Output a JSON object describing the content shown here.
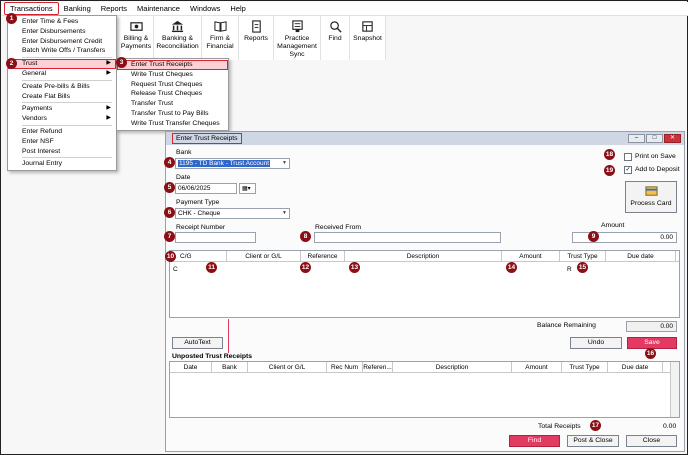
{
  "menubar": [
    "Transactions",
    "Banking",
    "Reports",
    "Maintenance",
    "Windows",
    "Help"
  ],
  "toolbar": [
    {
      "label": "Billing &\nPayments",
      "icon": "billing-icon"
    },
    {
      "label": "Banking &\nReconciliation",
      "icon": "bank-icon"
    },
    {
      "label": "Firm &\nFinancial",
      "icon": "book-icon"
    },
    {
      "label": "Reports",
      "icon": "report-icon"
    },
    {
      "label": "Practice\nManagement\nSync",
      "icon": "sync-icon"
    },
    {
      "label": "Find",
      "icon": "search-icon"
    },
    {
      "label": "Snapshot",
      "icon": "snapshot-icon"
    }
  ],
  "transactions_menu": [
    {
      "label": "Enter Time & Fees"
    },
    {
      "label": "Enter Disbursements"
    },
    {
      "label": "Enter Disbursement Credit"
    },
    {
      "label": "Batch Write Offs / Transfers"
    },
    {
      "sep": true
    },
    {
      "label": "Trust",
      "submenu": true
    },
    {
      "label": "General",
      "submenu": true
    },
    {
      "sep": true
    },
    {
      "label": "Create Pre-bills & Bills"
    },
    {
      "label": "Create Flat Bills"
    },
    {
      "sep": true
    },
    {
      "label": "Payments",
      "submenu": true
    },
    {
      "label": "Vendors",
      "submenu": true
    },
    {
      "sep": true
    },
    {
      "label": "Enter Refund"
    },
    {
      "label": "Enter NSF"
    },
    {
      "label": "Post Interest"
    },
    {
      "sep": true
    },
    {
      "label": "Journal Entry"
    }
  ],
  "trust_submenu": [
    "Enter Trust Receipts",
    "Write Trust Cheques",
    "Request Trust Cheques",
    "Release Trust Cheques",
    "Transfer Trust",
    "Transfer Trust to Pay Bills",
    "Write Trust Transfer Cheques"
  ],
  "dialog": {
    "title": "Enter Trust Receipts",
    "bank_label": "Bank",
    "bank_value": "1195 - TD Bank - Trust Account",
    "date_label": "Date",
    "date_value": "06/06/2025",
    "payment_type_label": "Payment Type",
    "payment_type_value": "CHK - Cheque",
    "receipt_number_label": "Receipt Number",
    "received_from_label": "Received From",
    "amount_label": "Amount",
    "amount_value": "0.00",
    "print_on_save": "Print on Save",
    "add_to_deposit": "Add to Deposit",
    "process_card": "Process Card",
    "grid_headers": [
      "C/G",
      "Client or G/L",
      "Reference",
      "Description",
      "Amount",
      "Trust Type",
      "Due date"
    ],
    "row_cg": "C",
    "row_trust_type": "R",
    "balance_remaining_label": "Balance Remaining",
    "balance_remaining_value": "0.00",
    "autotext": "AutoText",
    "undo": "Undo",
    "save": "Save",
    "unposted_label": "Unposted Trust Receipts",
    "unposted_headers": [
      "Date",
      "Bank",
      "Client or G/L",
      "Rec Num",
      "Referen...",
      "Description",
      "Amount",
      "Trust Type",
      "Due date"
    ],
    "total_receipts_label": "Total Receipts",
    "total_receipts_value": "0.00",
    "find": "Find",
    "post_close": "Post & Close",
    "close": "Close"
  },
  "colors": {
    "accent": "#d8242f",
    "badge": "#8a0f16",
    "button_pink": "#e23a62",
    "selection": "#2f68c9"
  }
}
